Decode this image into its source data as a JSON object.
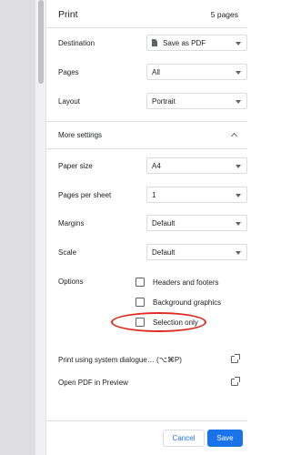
{
  "header": {
    "title": "Print",
    "page_count": "5 pages"
  },
  "settings": {
    "destination": {
      "label": "Destination",
      "value": "Save as PDF"
    },
    "pages": {
      "label": "Pages",
      "value": "All"
    },
    "layout": {
      "label": "Layout",
      "value": "Portrait"
    }
  },
  "more_settings": {
    "label": "More settings"
  },
  "advanced": {
    "paper_size": {
      "label": "Paper size",
      "value": "A4"
    },
    "pages_per_sheet": {
      "label": "Pages per sheet",
      "value": "1"
    },
    "margins": {
      "label": "Margins",
      "value": "Default"
    },
    "scale": {
      "label": "Scale",
      "value": "Default"
    }
  },
  "options": {
    "label": "Options",
    "items": [
      {
        "label": "Headers and footers",
        "checked": false
      },
      {
        "label": "Background graphics",
        "checked": false
      },
      {
        "label": "Selection only",
        "checked": false
      }
    ]
  },
  "links": {
    "system_dialog": "Print using system dialogue… (⌥⌘P)",
    "open_preview": "Open PDF in Preview"
  },
  "buttons": {
    "cancel": "Cancel",
    "save": "Save"
  },
  "colors": {
    "accent": "#1a73e8",
    "highlight": "#e02b20"
  }
}
